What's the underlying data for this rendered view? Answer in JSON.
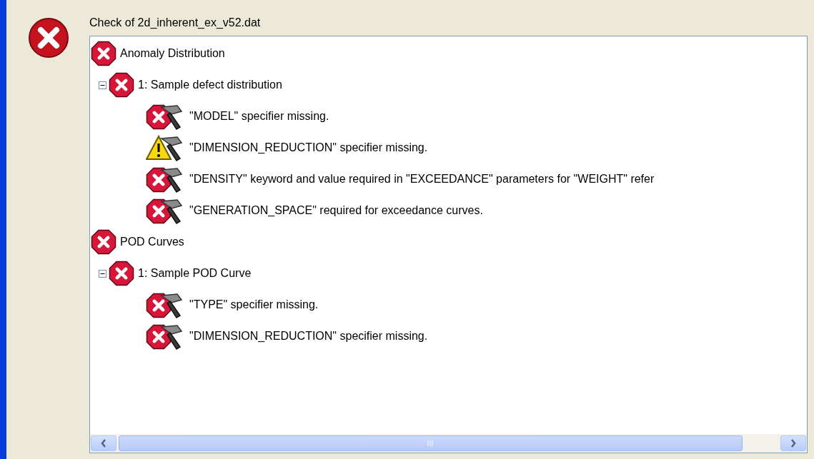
{
  "dialog": {
    "kind": "error",
    "title": "Check of 2d_inherent_ex_v52.dat"
  },
  "tree": [
    {
      "label": "Anomaly Distribution",
      "kind": "error",
      "children": [
        {
          "label": "1: Sample defect distribution",
          "kind": "error",
          "expanded": true,
          "children": [
            {
              "label": "\"MODEL\" specifier missing.",
              "kind": "error"
            },
            {
              "label": "\"DIMENSION_REDUCTION\" specifier missing.",
              "kind": "warning"
            },
            {
              "label": "\"DENSITY\" keyword and value required in \"EXCEEDANCE\" parameters for \"WEIGHT\" refer",
              "kind": "error"
            },
            {
              "label": "\"GENERATION_SPACE\" required for exceedance curves.",
              "kind": "error"
            }
          ]
        }
      ]
    },
    {
      "label": "POD Curves",
      "kind": "error",
      "children": [
        {
          "label": "1: Sample POD Curve",
          "kind": "error",
          "expanded": true,
          "children": [
            {
              "label": "\"TYPE\" specifier missing.",
              "kind": "error"
            },
            {
              "label": "\"DIMENSION_REDUCTION\" specifier missing.",
              "kind": "error"
            }
          ]
        }
      ]
    }
  ]
}
